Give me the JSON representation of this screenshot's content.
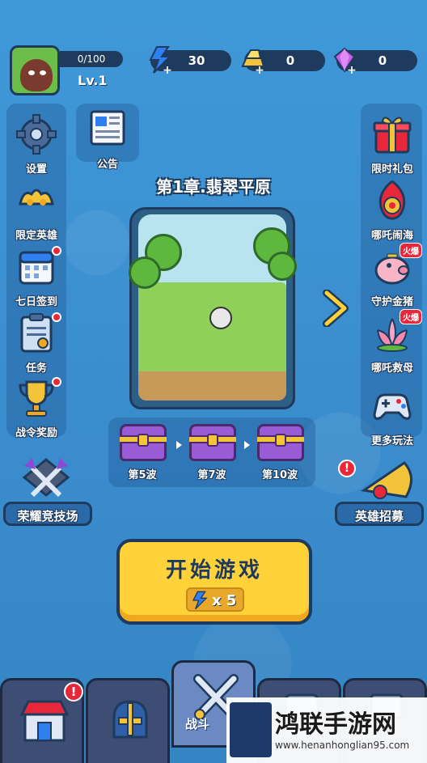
{
  "player": {
    "xp": "0/100",
    "level": "Lv.1"
  },
  "resources": [
    {
      "name": "energy",
      "value": "30",
      "icon": "lightning-icon",
      "color": "#2f7ff0"
    },
    {
      "name": "gold",
      "value": "0",
      "icon": "gold-bar-icon",
      "color": "#f3c43a"
    },
    {
      "name": "gems",
      "value": "0",
      "icon": "gem-icon",
      "color": "#c85ce8"
    }
  ],
  "left_menu": {
    "settings": "设置",
    "announcement": "公告",
    "limited_hero": "限定英雄",
    "seven_day": "七日签到",
    "tasks": "任务",
    "battle_pass": "战令奖励"
  },
  "right_menu": {
    "limited_gift": "限时礼包",
    "nezha_sea": "哪吒闹海",
    "guard_pig": "守护金猪",
    "nezha_mother": "哪吒救母",
    "more_games": "更多玩法",
    "hot_badge": "火爆"
  },
  "chapter": {
    "title": "第1章.翡翠平原"
  },
  "waves": [
    "第5波",
    "第7波",
    "第10波"
  ],
  "arena": "荣耀竞技场",
  "recruit": "英雄招募",
  "start": {
    "label": "开始游戏",
    "cost": "x 5"
  },
  "nav": {
    "battle": "战斗"
  },
  "watermark": {
    "title": "鸿联手游网",
    "url": "www.henanhonglian95.com"
  }
}
